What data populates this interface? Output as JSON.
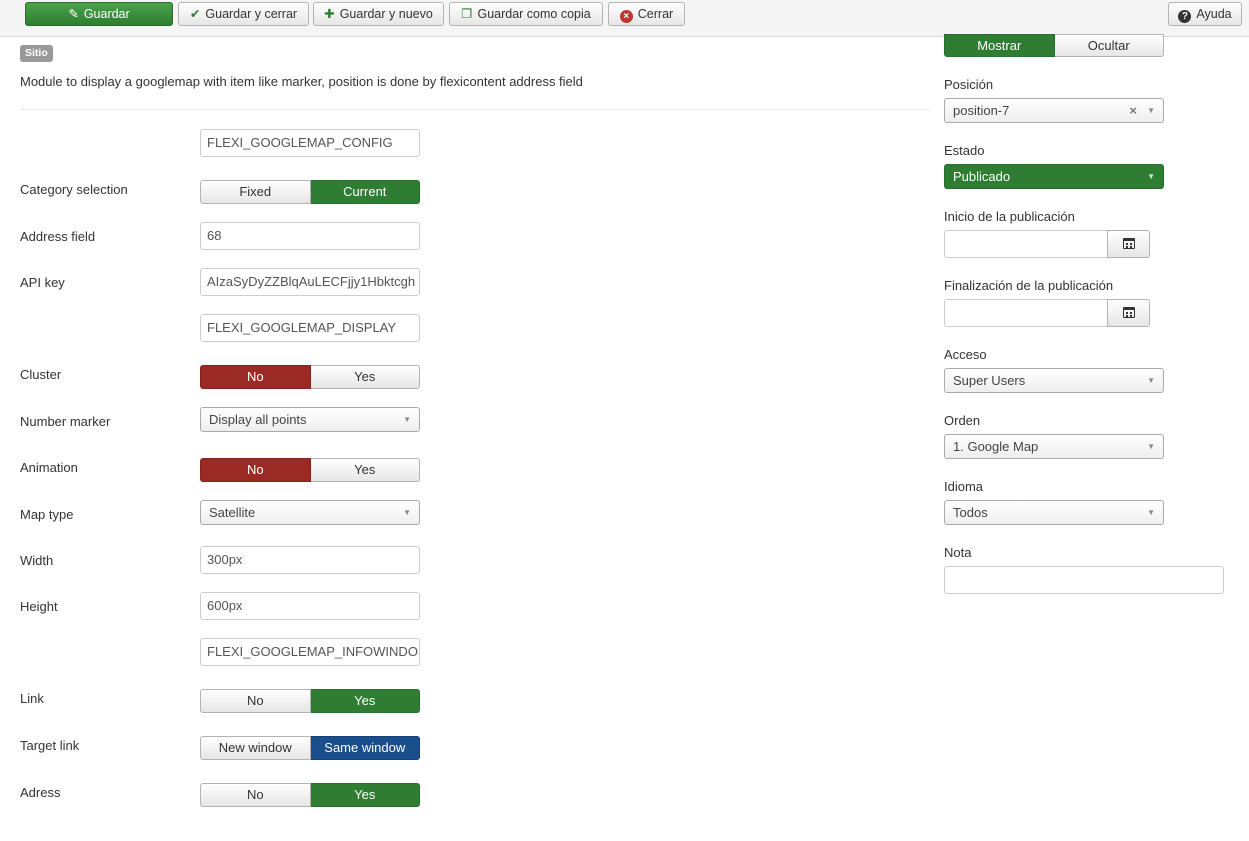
{
  "toolbar": {
    "save": "Guardar",
    "save_close": "Guardar y cerrar",
    "save_new": "Guardar y nuevo",
    "save_copy": "Guardar como copia",
    "close": "Cerrar",
    "help": "Ayuda"
  },
  "header": {
    "badge": "Sitio",
    "description": "Module to display a googlemap with item like marker, position is done by flexicontent address field"
  },
  "form": {
    "config_header": "FLEXI_GOOGLEMAP_CONFIG",
    "category_selection": {
      "label": "Category selection",
      "options": [
        "Fixed",
        "Current"
      ],
      "selected": "Current"
    },
    "address_field": {
      "label": "Address field",
      "value": "68"
    },
    "api_key": {
      "label": "API key",
      "value": "AIzaSyDyZZBlqAuLECFjjy1Hbktcgh"
    },
    "display_header": "FLEXI_GOOGLEMAP_DISPLAY",
    "cluster": {
      "label": "Cluster",
      "options": [
        "No",
        "Yes"
      ],
      "selected": "No"
    },
    "number_marker": {
      "label": "Number marker",
      "value": "Display all points"
    },
    "animation": {
      "label": "Animation",
      "options": [
        "No",
        "Yes"
      ],
      "selected": "No"
    },
    "map_type": {
      "label": "Map type",
      "value": "Satellite"
    },
    "width": {
      "label": "Width",
      "value": "300px"
    },
    "height": {
      "label": "Height",
      "value": "600px"
    },
    "infowindow_header": "FLEXI_GOOGLEMAP_INFOWINDO",
    "link": {
      "label": "Link",
      "options": [
        "No",
        "Yes"
      ],
      "selected": "Yes"
    },
    "target_link": {
      "label": "Target link",
      "options": [
        "New window",
        "Same window"
      ],
      "selected": "Same window"
    },
    "adress": {
      "label": "Adress",
      "options": [
        "No",
        "Yes"
      ],
      "selected": "Yes"
    }
  },
  "sidebar": {
    "show_title": {
      "options": [
        "Mostrar",
        "Ocultar"
      ],
      "selected": "Mostrar"
    },
    "position": {
      "label": "Posición",
      "value": "position-7"
    },
    "status": {
      "label": "Estado",
      "value": "Publicado"
    },
    "publish_up": {
      "label": "Inicio de la publicación",
      "value": ""
    },
    "publish_down": {
      "label": "Finalización de la publicación",
      "value": ""
    },
    "access": {
      "label": "Acceso",
      "value": "Super Users"
    },
    "ordering": {
      "label": "Orden",
      "value": "1. Google Map"
    },
    "language": {
      "label": "Idioma",
      "value": "Todos"
    },
    "note": {
      "label": "Nota",
      "value": ""
    }
  },
  "colors": {
    "primary_green": "#2f7d32",
    "danger_red": "#9b2a25",
    "active_blue": "#184f8c"
  }
}
